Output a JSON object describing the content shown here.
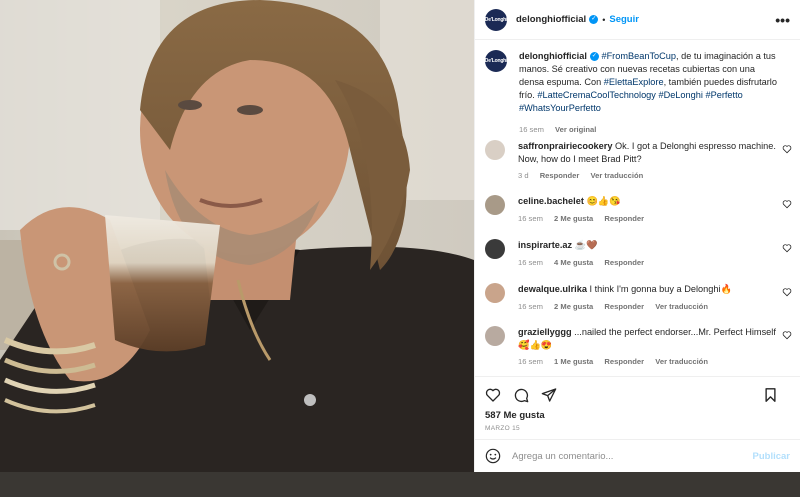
{
  "post": {
    "account": "delonghiofficial",
    "logo_text": "De'Longhi",
    "separator": "•",
    "follow_label": "Seguir",
    "more_icon": "•••"
  },
  "caption": {
    "author": "delonghiofficial",
    "tag1": "#FromBeanToCup",
    "text1": ", de tu imaginación a tus manos. Sé creativo con nuevas recetas cubiertas con una densa espuma. Con ",
    "tag2": "#ElettaExplore",
    "text2": ", también puedes disfrutarlo frío. ",
    "tag3": "#LatteCremaCoolTechnology",
    "tag4": "#DeLonghi",
    "tag5": "#Perfetto",
    "tag6": "#WhatsYourPerfetto",
    "age": "16 sem",
    "translate": "Ver original"
  },
  "comments": [
    {
      "user": "saffronprairiecookery",
      "text": "Ok. I got a Delonghi espresso machine. Now, how do I meet Brad Pitt?",
      "age": "3 d",
      "likes": "",
      "reply": "Responder",
      "translate": "Ver traducción",
      "avatar_color": "#d9cfc5"
    },
    {
      "user": "celine.bachelet",
      "text": "😊👍😘",
      "age": "16 sem",
      "likes": "2 Me gusta",
      "reply": "Responder",
      "translate": "",
      "avatar_color": "#a89a88"
    },
    {
      "user": "inspirarte.az",
      "text": "☕🤎",
      "age": "16 sem",
      "likes": "4 Me gusta",
      "reply": "Responder",
      "translate": "",
      "avatar_color": "#3a3a3a"
    },
    {
      "user": "dewalque.ulrika",
      "text": "I think I'm gonna buy a Delonghi🔥",
      "age": "16 sem",
      "likes": "2 Me gusta",
      "reply": "Responder",
      "translate": "Ver traducción",
      "avatar_color": "#c9a48b"
    },
    {
      "user": "graziellyggg",
      "text": "...nailed the perfect endorser...Mr. Perfect Himself 🥰👍😍",
      "age": "16 sem",
      "likes": "1 Me gusta",
      "reply": "Responder",
      "translate": "Ver traducción",
      "avatar_color": "#b8aaa0"
    }
  ],
  "footer": {
    "likes": "587 Me gusta",
    "date": "MARZO 15",
    "comment_placeholder": "Agrega un comentario...",
    "publish_label": "Publicar"
  },
  "colors": {
    "accent": "#0095f6",
    "hashtag": "#00376b",
    "brand": "#1b2a55"
  }
}
